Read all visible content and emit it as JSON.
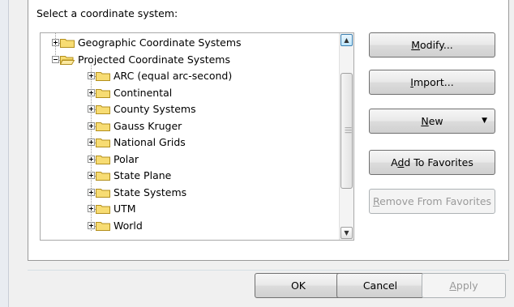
{
  "dialog": {
    "section_label": "Select a coordinate system:"
  },
  "tree": {
    "items": [
      {
        "label": "Geographic Coordinate Systems",
        "expander": "plus",
        "icon": "folder-closed-icon"
      },
      {
        "label": "Projected Coordinate Systems",
        "expander": "minus",
        "icon": "folder-open-icon"
      },
      {
        "label": "ARC (equal arc-second)",
        "expander": "plus",
        "icon": "folder-closed-icon"
      },
      {
        "label": "Continental",
        "expander": "plus",
        "icon": "folder-closed-icon"
      },
      {
        "label": "County Systems",
        "expander": "plus",
        "icon": "folder-closed-icon"
      },
      {
        "label": "Gauss Kruger",
        "expander": "plus",
        "icon": "folder-closed-icon"
      },
      {
        "label": "National Grids",
        "expander": "plus",
        "icon": "folder-closed-icon"
      },
      {
        "label": "Polar",
        "expander": "plus",
        "icon": "folder-closed-icon"
      },
      {
        "label": "State Plane",
        "expander": "plus",
        "icon": "folder-closed-icon"
      },
      {
        "label": "State Systems",
        "expander": "plus",
        "icon": "folder-closed-icon"
      },
      {
        "label": "UTM",
        "expander": "plus",
        "icon": "folder-closed-icon"
      },
      {
        "label": "World",
        "expander": "plus",
        "icon": "folder-closed-icon"
      }
    ]
  },
  "side_buttons": {
    "modify_pre": "M",
    "modify_post": "odify...",
    "import_pre": "I",
    "import_post": "mport...",
    "new_pre": "N",
    "new_post": "ew",
    "favorites_pre": "A",
    "favorites_mid": "d",
    "favorites_post": "d To Favorites",
    "remove_pre": "R",
    "remove_post": "emove From Favorites"
  },
  "footer": {
    "ok": "OK",
    "cancel": "Cancel",
    "apply_pre": "A",
    "apply_post": "pply"
  },
  "colors": {
    "folder_fill": "#f7dc73",
    "folder_edge": "#b38f1d",
    "scroll_accent": "#3c7fb1"
  }
}
